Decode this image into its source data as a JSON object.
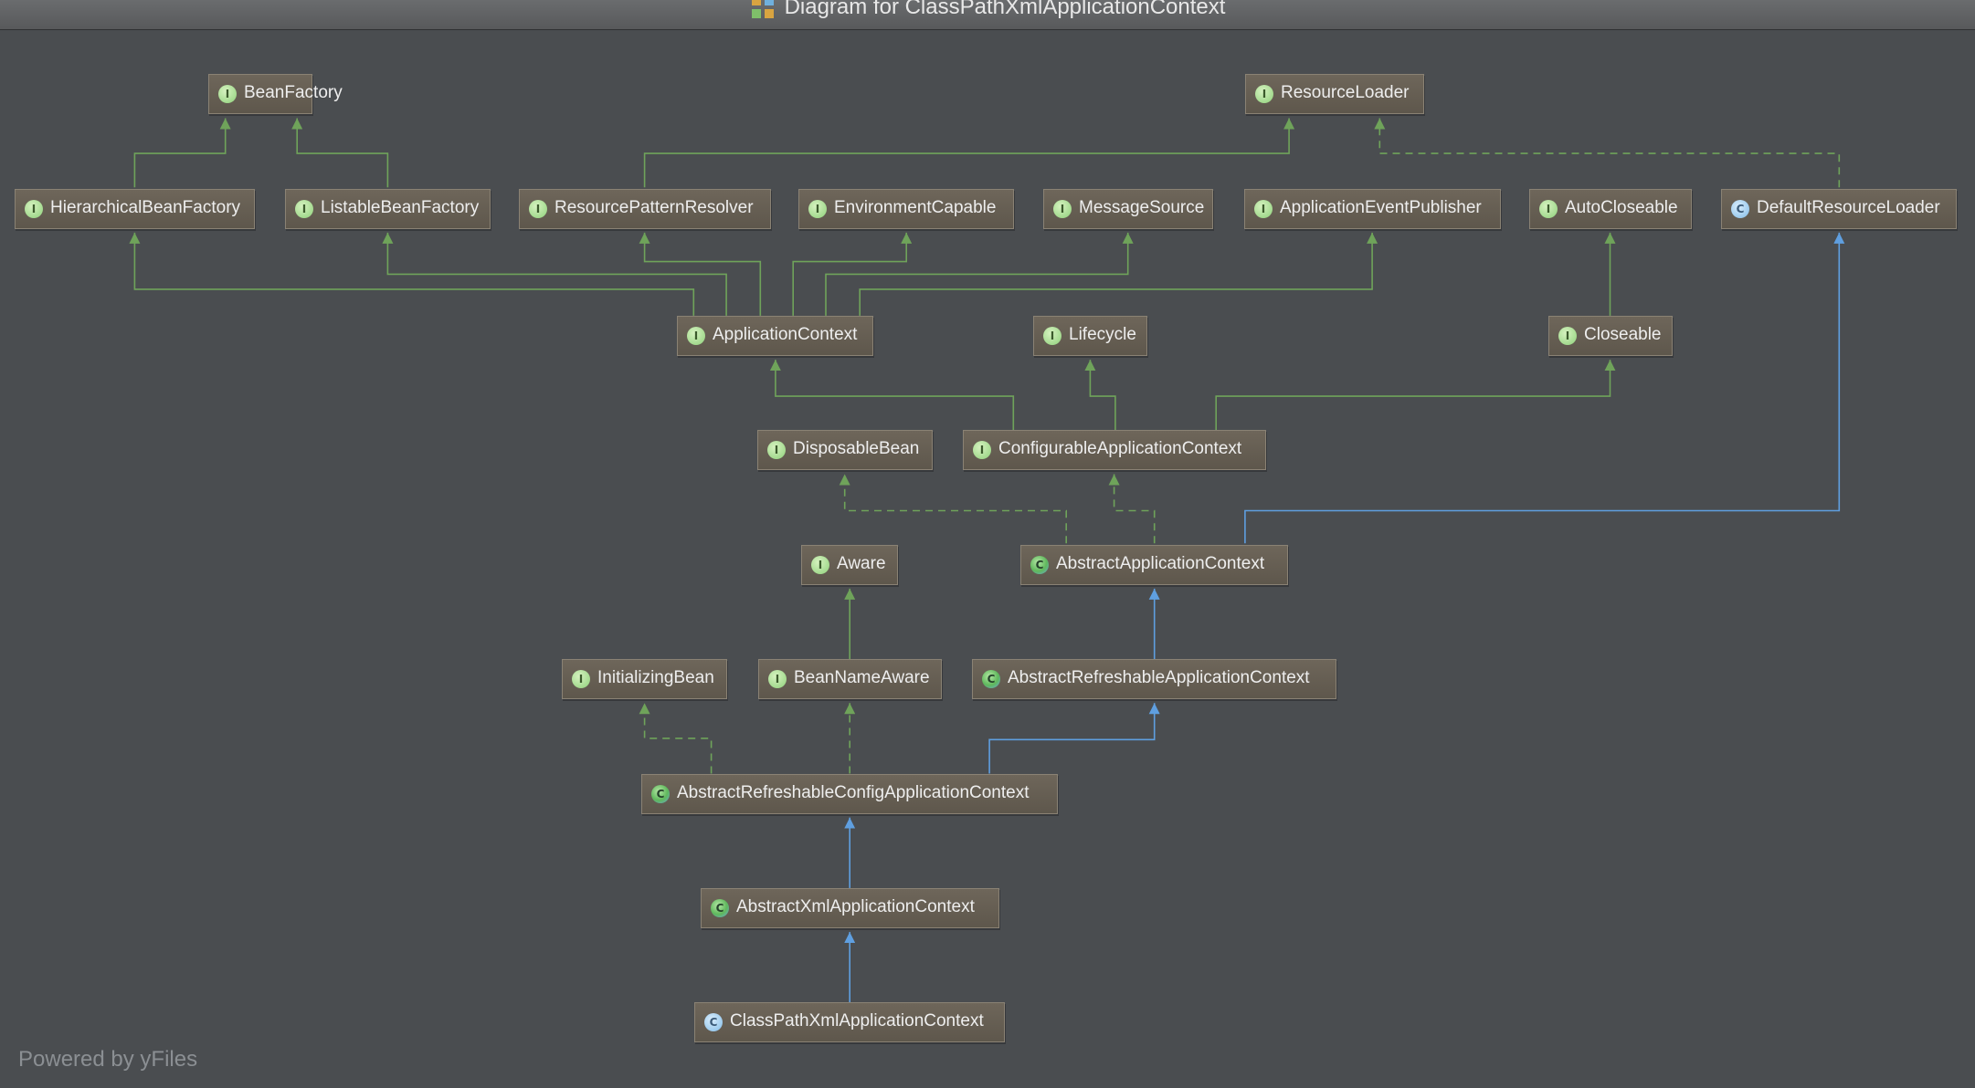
{
  "window": {
    "title": "Diagram for ClassPathXmlApplicationContext"
  },
  "footer": "Powered by yFiles",
  "colors": {
    "background": "#4a4d50",
    "interface_edge": "#6fa35a",
    "class_edge": "#5f9fe0"
  },
  "nodes": {
    "BeanFactory": {
      "label": "BeanFactory",
      "kind": "interface",
      "badge": "I"
    },
    "ResourceLoader": {
      "label": "ResourceLoader",
      "kind": "interface",
      "badge": "I"
    },
    "HierarchicalBeanFactory": {
      "label": "HierarchicalBeanFactory",
      "kind": "interface",
      "badge": "I"
    },
    "ListableBeanFactory": {
      "label": "ListableBeanFactory",
      "kind": "interface",
      "badge": "I"
    },
    "ResourcePatternResolver": {
      "label": "ResourcePatternResolver",
      "kind": "interface",
      "badge": "I"
    },
    "EnvironmentCapable": {
      "label": "EnvironmentCapable",
      "kind": "interface",
      "badge": "I"
    },
    "MessageSource": {
      "label": "MessageSource",
      "kind": "interface",
      "badge": "I"
    },
    "ApplicationEventPublisher": {
      "label": "ApplicationEventPublisher",
      "kind": "interface",
      "badge": "I"
    },
    "AutoCloseable": {
      "label": "AutoCloseable",
      "kind": "interface",
      "badge": "I"
    },
    "DefaultResourceLoader": {
      "label": "DefaultResourceLoader",
      "kind": "class",
      "badge": "C"
    },
    "ApplicationContext": {
      "label": "ApplicationContext",
      "kind": "interface",
      "badge": "I"
    },
    "Lifecycle": {
      "label": "Lifecycle",
      "kind": "interface",
      "badge": "I"
    },
    "Closeable": {
      "label": "Closeable",
      "kind": "interface",
      "badge": "I"
    },
    "DisposableBean": {
      "label": "DisposableBean",
      "kind": "interface",
      "badge": "I"
    },
    "ConfigurableApplicationContext": {
      "label": "ConfigurableApplicationContext",
      "kind": "interface",
      "badge": "I"
    },
    "Aware": {
      "label": "Aware",
      "kind": "interface",
      "badge": "I"
    },
    "AbstractApplicationContext": {
      "label": "AbstractApplicationContext",
      "kind": "abstract",
      "badge": "C"
    },
    "InitializingBean": {
      "label": "InitializingBean",
      "kind": "interface",
      "badge": "I"
    },
    "BeanNameAware": {
      "label": "BeanNameAware",
      "kind": "interface",
      "badge": "I"
    },
    "AbstractRefreshableApplicationContext": {
      "label": "AbstractRefreshableApplicationContext",
      "kind": "abstract",
      "badge": "C"
    },
    "AbstractRefreshableConfigApplicationContext": {
      "label": "AbstractRefreshableConfigApplicationContext",
      "kind": "abstract",
      "badge": "C"
    },
    "AbstractXmlApplicationContext": {
      "label": "AbstractXmlApplicationContext",
      "kind": "abstract",
      "badge": "C"
    },
    "ClassPathXmlApplicationContext": {
      "label": "ClassPathXmlApplicationContext",
      "kind": "class",
      "badge": "C"
    }
  },
  "edges": [
    {
      "from": "HierarchicalBeanFactory",
      "to": "BeanFactory",
      "type": "extends"
    },
    {
      "from": "ListableBeanFactory",
      "to": "BeanFactory",
      "type": "extends"
    },
    {
      "from": "ResourcePatternResolver",
      "to": "ResourceLoader",
      "type": "extends"
    },
    {
      "from": "DefaultResourceLoader",
      "to": "ResourceLoader",
      "type": "implements"
    },
    {
      "from": "ApplicationContext",
      "to": "HierarchicalBeanFactory",
      "type": "extends"
    },
    {
      "from": "ApplicationContext",
      "to": "ListableBeanFactory",
      "type": "extends"
    },
    {
      "from": "ApplicationContext",
      "to": "ResourcePatternResolver",
      "type": "extends"
    },
    {
      "from": "ApplicationContext",
      "to": "EnvironmentCapable",
      "type": "extends"
    },
    {
      "from": "ApplicationContext",
      "to": "MessageSource",
      "type": "extends"
    },
    {
      "from": "ApplicationContext",
      "to": "ApplicationEventPublisher",
      "type": "extends"
    },
    {
      "from": "Closeable",
      "to": "AutoCloseable",
      "type": "extends"
    },
    {
      "from": "ConfigurableApplicationContext",
      "to": "ApplicationContext",
      "type": "extends"
    },
    {
      "from": "ConfigurableApplicationContext",
      "to": "Lifecycle",
      "type": "extends"
    },
    {
      "from": "ConfigurableApplicationContext",
      "to": "Closeable",
      "type": "extends"
    },
    {
      "from": "AbstractApplicationContext",
      "to": "DisposableBean",
      "type": "implements"
    },
    {
      "from": "AbstractApplicationContext",
      "to": "ConfigurableApplicationContext",
      "type": "implements"
    },
    {
      "from": "AbstractApplicationContext",
      "to": "DefaultResourceLoader",
      "type": "class-extends"
    },
    {
      "from": "BeanNameAware",
      "to": "Aware",
      "type": "extends"
    },
    {
      "from": "AbstractRefreshableApplicationContext",
      "to": "AbstractApplicationContext",
      "type": "class-extends"
    },
    {
      "from": "AbstractRefreshableConfigApplicationContext",
      "to": "InitializingBean",
      "type": "implements"
    },
    {
      "from": "AbstractRefreshableConfigApplicationContext",
      "to": "BeanNameAware",
      "type": "implements"
    },
    {
      "from": "AbstractRefreshableConfigApplicationContext",
      "to": "AbstractRefreshableApplicationContext",
      "type": "class-extends"
    },
    {
      "from": "AbstractXmlApplicationContext",
      "to": "AbstractRefreshableConfigApplicationContext",
      "type": "class-extends"
    },
    {
      "from": "ClassPathXmlApplicationContext",
      "to": "AbstractXmlApplicationContext",
      "type": "class-extends"
    }
  ]
}
